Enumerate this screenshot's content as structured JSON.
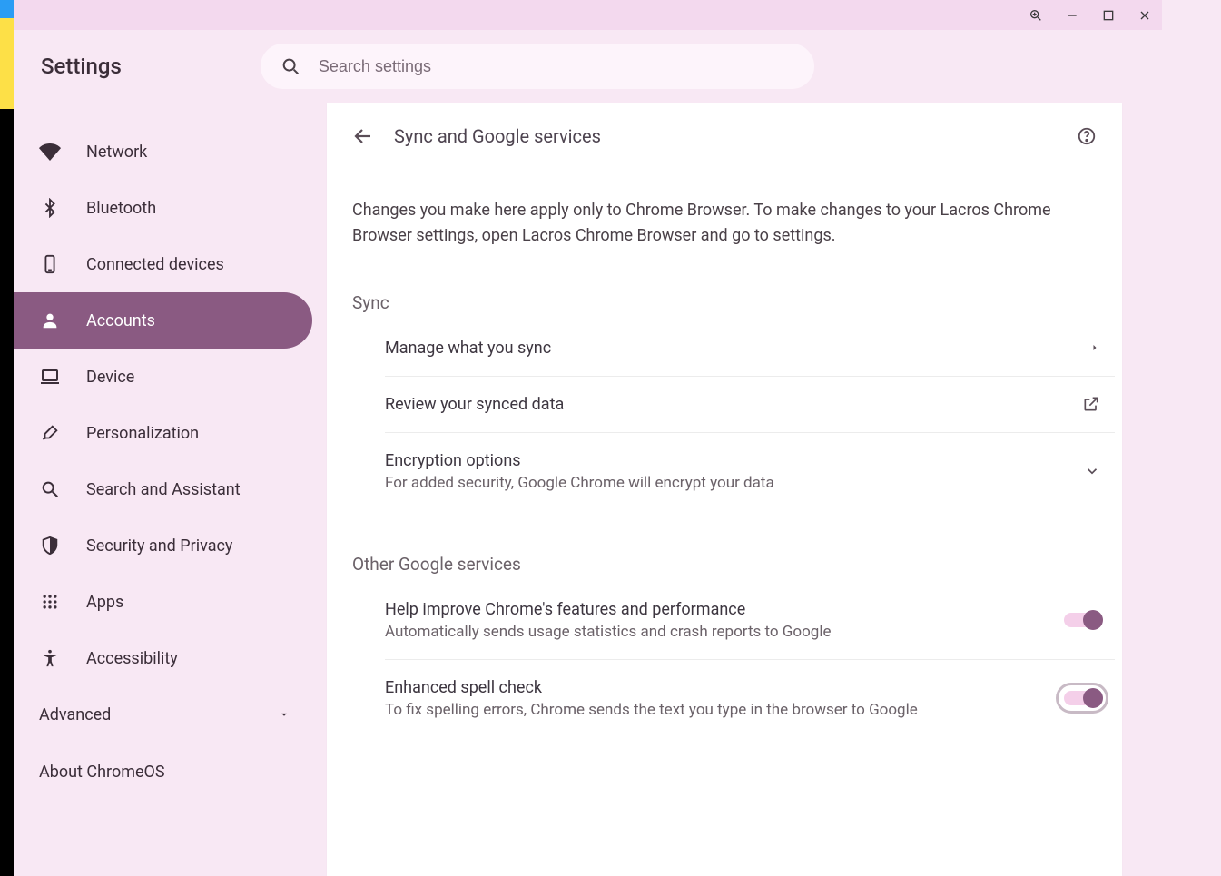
{
  "window": {
    "app_title": "Settings"
  },
  "search": {
    "placeholder": "Search settings",
    "value": ""
  },
  "sidebar": {
    "items": [
      {
        "id": "network",
        "label": "Network"
      },
      {
        "id": "bluetooth",
        "label": "Bluetooth"
      },
      {
        "id": "connected-devices",
        "label": "Connected devices"
      },
      {
        "id": "accounts",
        "label": "Accounts"
      },
      {
        "id": "device",
        "label": "Device"
      },
      {
        "id": "personalization",
        "label": "Personalization"
      },
      {
        "id": "search-assistant",
        "label": "Search and Assistant"
      },
      {
        "id": "security-privacy",
        "label": "Security and Privacy"
      },
      {
        "id": "apps",
        "label": "Apps"
      },
      {
        "id": "accessibility",
        "label": "Accessibility"
      }
    ],
    "advanced_label": "Advanced",
    "about_label": "About ChromeOS",
    "active_id": "accounts"
  },
  "main": {
    "page_title": "Sync and Google services",
    "description": "Changes you make here apply only to Chrome Browser. To make changes to your Lacros Chrome Browser settings, open Lacros Chrome Browser and go to settings.",
    "sections": {
      "sync": {
        "title": "Sync",
        "rows": [
          {
            "title": "Manage what you sync",
            "sub": "",
            "trailing": "arrow"
          },
          {
            "title": "Review your synced data",
            "sub": "",
            "trailing": "external"
          },
          {
            "title": "Encryption options",
            "sub": "For added security, Google Chrome will encrypt your data",
            "trailing": "expand"
          }
        ]
      },
      "other": {
        "title": "Other Google services",
        "rows": [
          {
            "title": "Help improve Chrome's features and performance",
            "sub": "Automatically sends usage statistics and crash reports to Google",
            "toggle": true,
            "focused": false
          },
          {
            "title": "Enhanced spell check",
            "sub": "To fix spelling errors, Chrome sends the text you type in the browser to Google",
            "toggle": true,
            "focused": true
          }
        ]
      }
    }
  }
}
